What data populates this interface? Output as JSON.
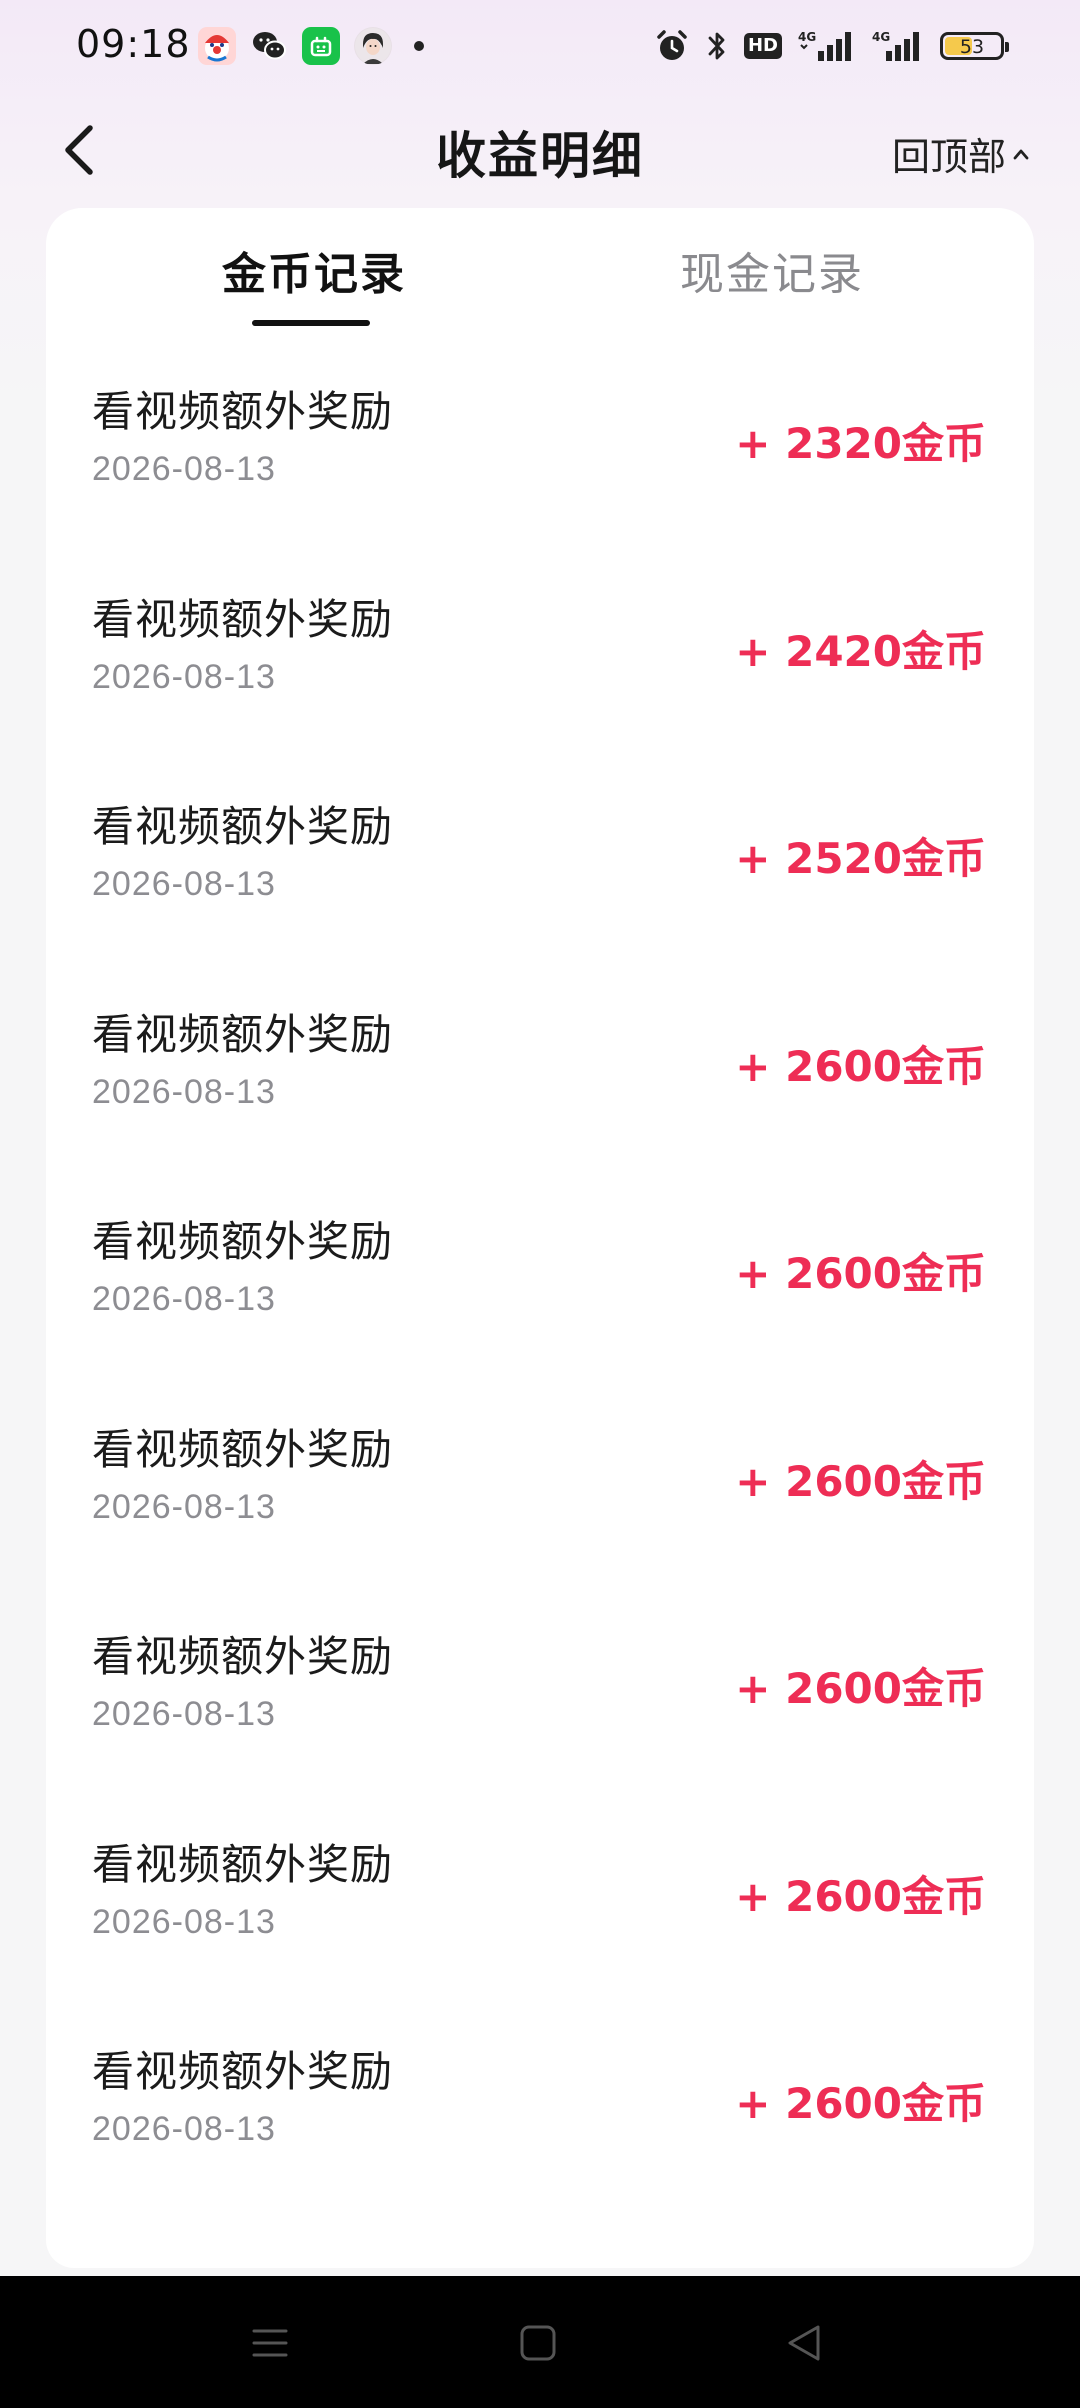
{
  "status_bar": {
    "time": "09:18",
    "battery_level": "53",
    "battery_fraction": 0.53,
    "hd_label": "HD",
    "icons": [
      "app-clown-icon",
      "wechat-icon",
      "green-app-icon",
      "avatar-app-icon",
      "notification-dot",
      "alarm-icon",
      "bluetooth-icon",
      "hd-icon",
      "signal-4g-icon",
      "signal-4g-icon",
      "battery-icon"
    ]
  },
  "header": {
    "title": "收益明细",
    "back_to_top_label": "回顶部"
  },
  "tabs": [
    {
      "label": "金币记录",
      "active": true
    },
    {
      "label": "现金记录",
      "active": false
    }
  ],
  "records": [
    {
      "title": "看视频额外奖励",
      "date": "2026-08-13",
      "amount": "+ 2320金币"
    },
    {
      "title": "看视频额外奖励",
      "date": "2026-08-13",
      "amount": "+ 2420金币"
    },
    {
      "title": "看视频额外奖励",
      "date": "2026-08-13",
      "amount": "+ 2520金币"
    },
    {
      "title": "看视频额外奖励",
      "date": "2026-08-13",
      "amount": "+ 2600金币"
    },
    {
      "title": "看视频额外奖励",
      "date": "2026-08-13",
      "amount": "+ 2600金币"
    },
    {
      "title": "看视频额外奖励",
      "date": "2026-08-13",
      "amount": "+ 2600金币"
    },
    {
      "title": "看视频额外奖励",
      "date": "2026-08-13",
      "amount": "+ 2600金币"
    },
    {
      "title": "看视频额外奖励",
      "date": "2026-08-13",
      "amount": "+ 2600金币"
    },
    {
      "title": "看视频额外奖励",
      "date": "2026-08-13",
      "amount": "+ 2600金币"
    }
  ],
  "colors": {
    "amount": "#ee2d55",
    "active_tab": "#111111",
    "inactive_tab": "#8a8a8e",
    "date": "#8d8d92",
    "battery_fill": "#f5c94c"
  }
}
